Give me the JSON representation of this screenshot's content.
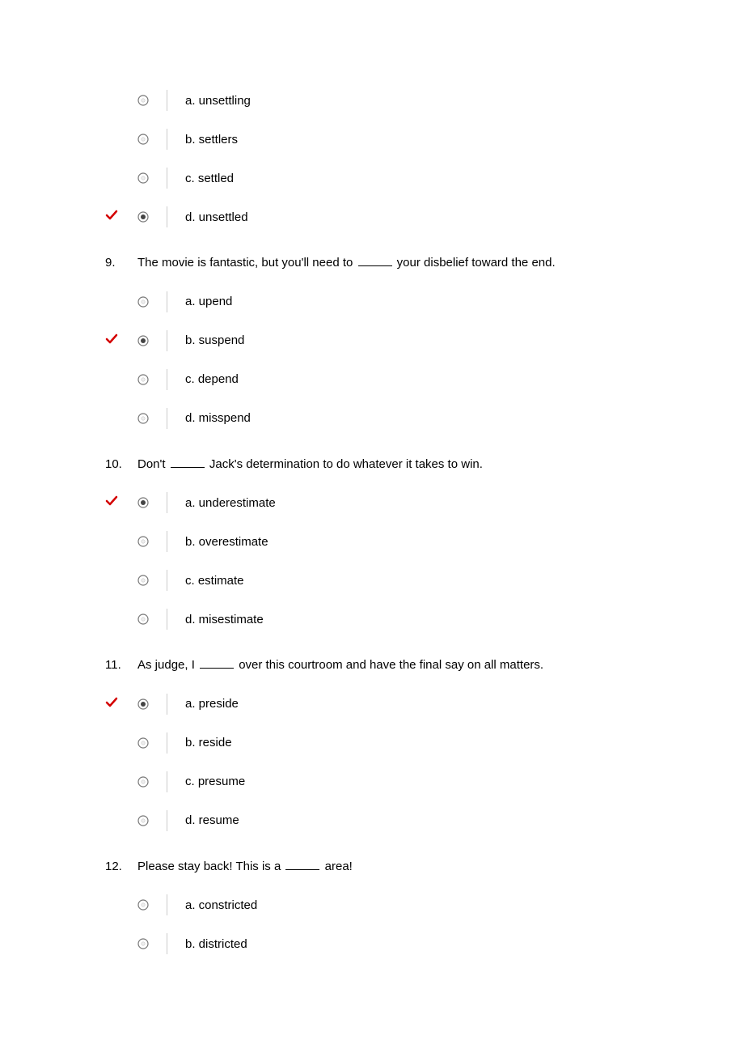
{
  "questions": [
    {
      "number": "",
      "text_before": "",
      "text_after": "",
      "show_prompt": false,
      "options": [
        {
          "label": "a. unsettling",
          "selected": false,
          "correct": false
        },
        {
          "label": "b. settlers",
          "selected": false,
          "correct": false
        },
        {
          "label": "c. settled",
          "selected": false,
          "correct": false
        },
        {
          "label": "d. unsettled",
          "selected": true,
          "correct": true
        }
      ]
    },
    {
      "number": "9.",
      "text_before": "The movie is fantastic, but you'll need to ",
      "text_after": " your disbelief toward the end.",
      "show_prompt": true,
      "options": [
        {
          "label": "a. upend",
          "selected": false,
          "correct": false
        },
        {
          "label": "b. suspend",
          "selected": true,
          "correct": true
        },
        {
          "label": "c. depend",
          "selected": false,
          "correct": false
        },
        {
          "label": "d. misspend",
          "selected": false,
          "correct": false
        }
      ]
    },
    {
      "number": "10.",
      "text_before": "Don't ",
      "text_after": " Jack's determination to do whatever it takes to win.",
      "show_prompt": true,
      "options": [
        {
          "label": "a. underestimate",
          "selected": true,
          "correct": true
        },
        {
          "label": "b. overestimate",
          "selected": false,
          "correct": false
        },
        {
          "label": "c. estimate",
          "selected": false,
          "correct": false
        },
        {
          "label": "d. misestimate",
          "selected": false,
          "correct": false
        }
      ]
    },
    {
      "number": "11.",
      "text_before": "As judge, I ",
      "text_after": " over this courtroom and have the final say on all matters.",
      "show_prompt": true,
      "options": [
        {
          "label": "a. preside",
          "selected": true,
          "correct": true
        },
        {
          "label": "b. reside",
          "selected": false,
          "correct": false
        },
        {
          "label": "c. presume",
          "selected": false,
          "correct": false
        },
        {
          "label": "d. resume",
          "selected": false,
          "correct": false
        }
      ]
    },
    {
      "number": "12.",
      "text_before": "Please stay back! This is a ",
      "text_after": " area!",
      "show_prompt": true,
      "options": [
        {
          "label": "a. constricted",
          "selected": false,
          "correct": false
        },
        {
          "label": "b. districted",
          "selected": false,
          "correct": false
        }
      ]
    }
  ]
}
